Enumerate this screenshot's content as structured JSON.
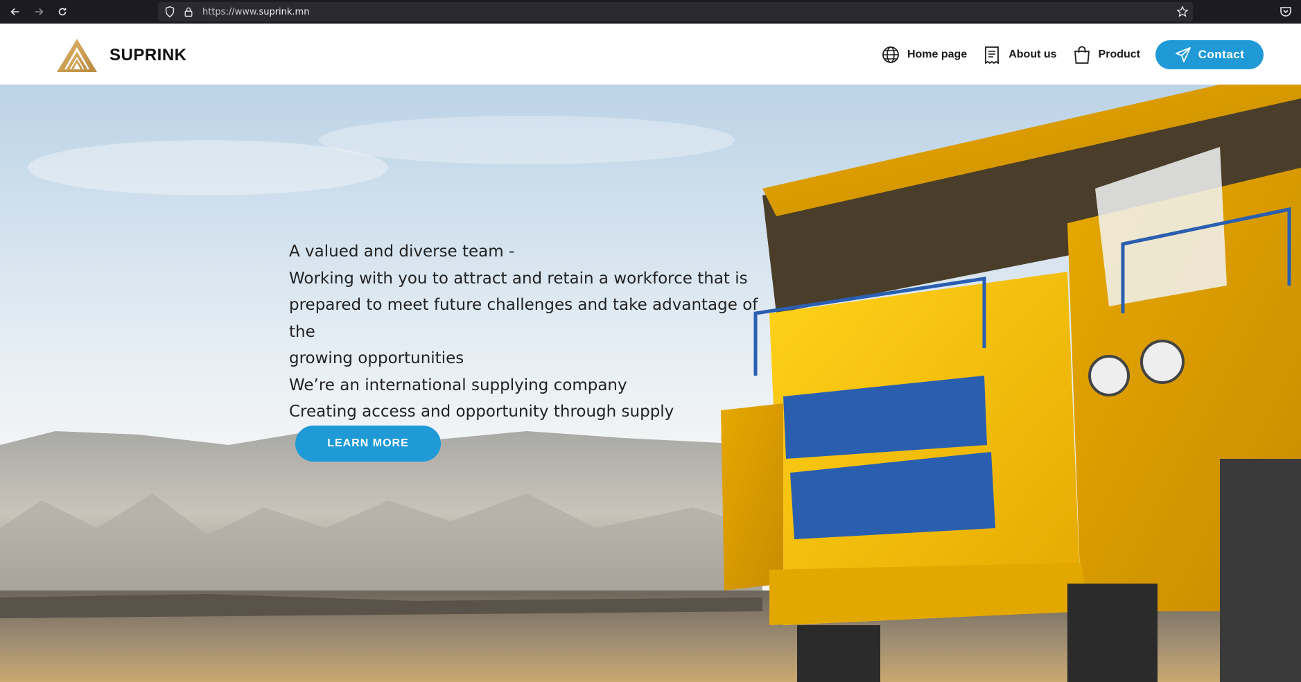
{
  "browser": {
    "url_prefix": "https://www.",
    "url_domain": "suprink.mn"
  },
  "header": {
    "brand": "SUPRINK",
    "nav": [
      {
        "label": "Home page",
        "icon": "globe-icon"
      },
      {
        "label": "About us",
        "icon": "document-icon"
      },
      {
        "label": "Product",
        "icon": "shopping-bag-icon"
      }
    ],
    "contact_label": "Contact",
    "contact_icon": "paper-plane-icon"
  },
  "hero": {
    "lines": [
      "A valued and diverse team -",
      "Working with you to attract and retain a workforce that is",
      "prepared to meet future challenges and take advantage of the",
      "growing opportunities",
      "We’re an international supplying company",
      "Creating access and opportunity through supply"
    ],
    "button_label": "LEARN MORE"
  },
  "colors": {
    "accent": "#1f9ad6",
    "browser_bg": "#1c1b22",
    "truck_yellow": "#f2c200"
  }
}
